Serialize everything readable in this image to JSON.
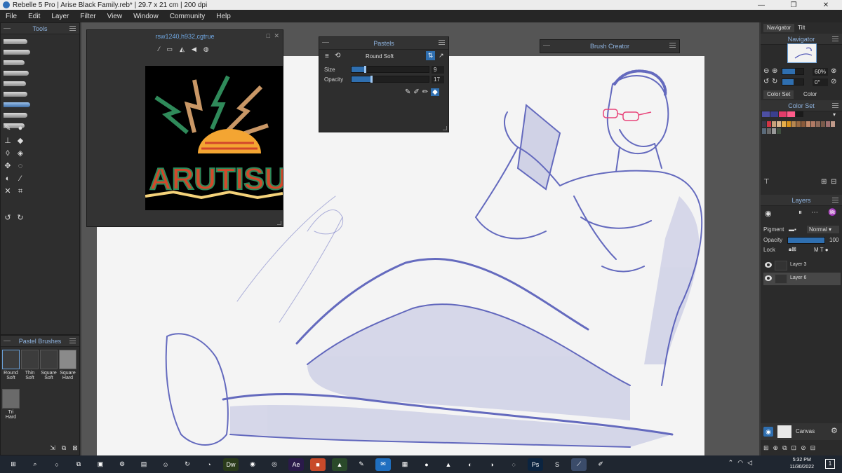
{
  "titlebar": {
    "title": "Rebelle 5 Pro | Arise Black Family.reb* | 29.7 x 21 cm | 200 dpi",
    "minimize": "—",
    "maximize": "❐",
    "close": "✕"
  },
  "menu": [
    "File",
    "Edit",
    "Layer",
    "Filter",
    "View",
    "Window",
    "Community",
    "Help"
  ],
  "tools_panel": {
    "title": "Tools"
  },
  "pastel_brushes": {
    "title": "Pastel Brushes",
    "items": [
      {
        "line1": "Round",
        "line2": "Soft"
      },
      {
        "line1": "Thin",
        "line2": "Soft"
      },
      {
        "line1": "Square",
        "line2": "Soft"
      },
      {
        "line1": "Square",
        "line2": "Hard"
      },
      {
        "line1": "Tri Hard",
        "line2": ""
      }
    ]
  },
  "reference": {
    "title": "rsw1240,h932,cgtrue",
    "logo_text": "ARUTISU"
  },
  "pastels": {
    "title": "Pastels",
    "brush_name": "Round Soft",
    "size_label": "Size",
    "size_value": "9",
    "size_level": 0.09,
    "opacity_label": "Opacity",
    "opacity_value": "17",
    "opacity_level": 0.17
  },
  "brush_creator": {
    "title": "Brush Creator"
  },
  "right": {
    "tabs": [
      "Navigator",
      "Tilt"
    ],
    "navigator_title": "Navigator",
    "zoom": "60%",
    "rotation": "0°",
    "color_tabs": [
      "Color Set",
      "Color"
    ],
    "color_set_title": "Color Set",
    "layers_title": "Layers",
    "pigment_label": "Pigment",
    "blend_mode": "Normal",
    "opacity_label": "Opacity",
    "opacity_value": "100",
    "lock_label": "Lock",
    "layers": [
      "Layer 3",
      "Layer 6"
    ],
    "canvas_label": "Canvas"
  },
  "colors": {
    "accent": "#2f6fb0",
    "pastel_blue": "#4b52b5",
    "swatches_row1": [
      "#4d4fa3",
      "#3a3f8e",
      "#e23c6a",
      "#ff5b8a",
      "#1a1a1a"
    ],
    "swatches_row2": [
      "#3a3a4a",
      "#d23545",
      "#c8a27a",
      "#d9b78f",
      "#e8b04b",
      "#d8931d",
      "#b8874f",
      "#9a6a42",
      "#8a5a3a",
      "#c48a6a",
      "#b07a64",
      "#8e6a5a",
      "#7a5a4a",
      "#a07070",
      "#c09a8a"
    ],
    "swatches_row3": [
      "#5a6a7a",
      "#6a6a6a",
      "#9a9a9a",
      "#3f4f3f"
    ]
  },
  "taskbar": {
    "time": "5:32 PM",
    "date": "11/30/2022",
    "notifications": "1",
    "apps": [
      "windows-icon",
      "search-icon",
      "cortana-icon",
      "task-view-icon",
      "store-icon",
      "settings-icon",
      "explorer-icon",
      "emoji-app-icon",
      "sync-icon",
      "edge-icon",
      "dreamweaver-icon",
      "firefox-icon",
      "chrome-icon",
      "after-effects-icon",
      "app-red-icon",
      "app-green-icon",
      "app-pen-icon",
      "mail-icon",
      "app-photo-icon",
      "app-circle-icon",
      "app-triangle-icon",
      "app-dark-icon",
      "app-messenger-icon",
      "app-swirl-icon",
      "photoshop-icon",
      "sketchbook-icon",
      "rebelle-icon",
      "krita-icon"
    ]
  }
}
